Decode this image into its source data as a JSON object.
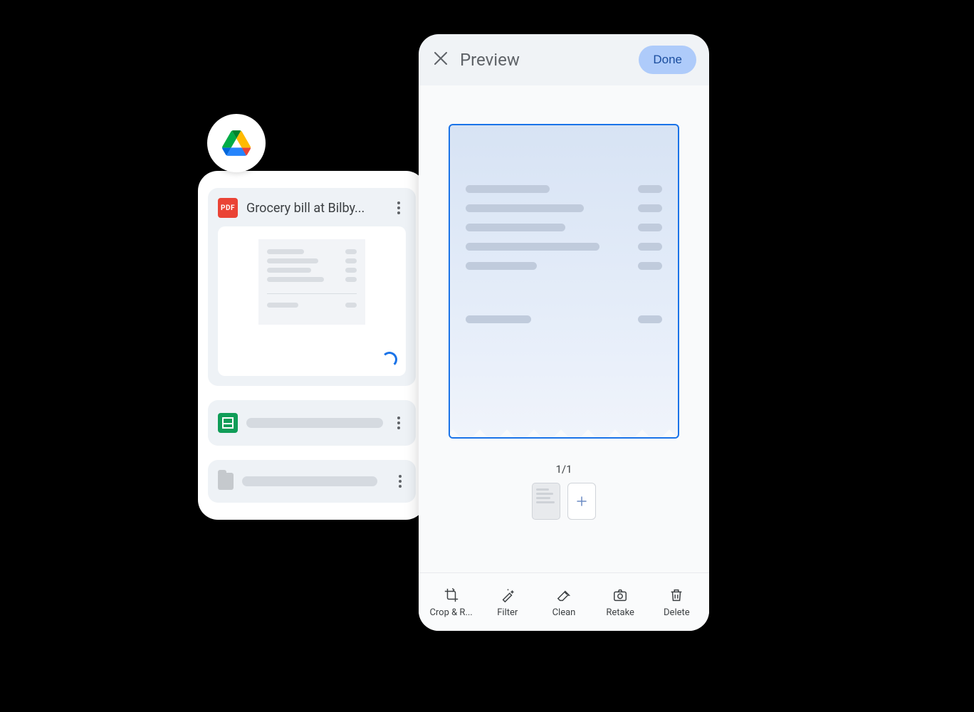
{
  "drive": {
    "files": [
      {
        "type": "pdf",
        "title": "Grocery bill at Bilby...",
        "status": "loading"
      },
      {
        "type": "sheet",
        "title": ""
      },
      {
        "type": "folder",
        "title": ""
      }
    ]
  },
  "preview": {
    "title": "Preview",
    "done_label": "Done",
    "page_counter": "1/1",
    "toolbar": {
      "crop": "Crop & R...",
      "filter": "Filter",
      "clean": "Clean",
      "retake": "Retake",
      "delete": "Delete"
    }
  },
  "icons": {
    "pdf_badge": "PDF"
  }
}
